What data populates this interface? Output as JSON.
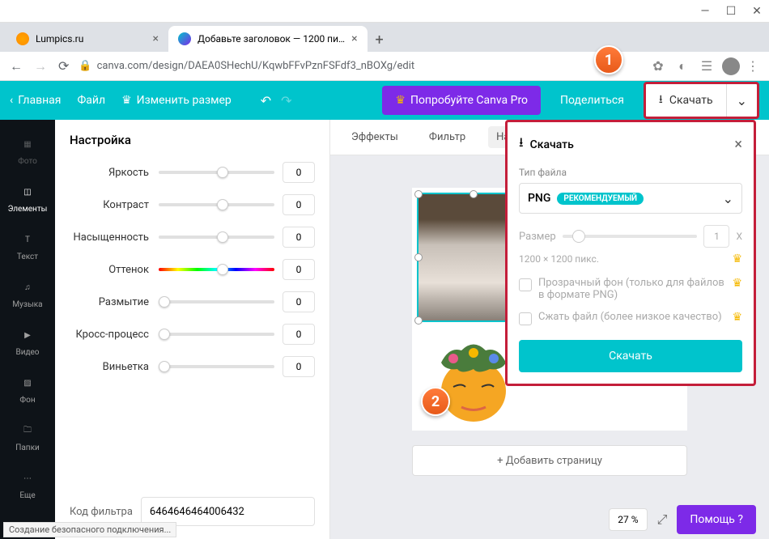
{
  "window": {
    "minimize": "—",
    "maximize": "☐",
    "close": "✕"
  },
  "tabs": [
    {
      "title": "Lumpics.ru"
    },
    {
      "title": "Добавьте заголовок — 1200 пи…"
    }
  ],
  "url": "canva.com/design/DAEA0SHechU/KqwbFFvPznFSFdf3_nBOXg/edit",
  "callouts": {
    "one": "1",
    "two": "2"
  },
  "menubar": {
    "home": "Главная",
    "file": "Файл",
    "resize": "Изменить размер",
    "try_pro": "Попробуйте Canva Pro",
    "share": "Поделиться",
    "download": "Скачать"
  },
  "sidenav": {
    "photo": "Фото",
    "elements": "Элементы",
    "text": "Текст",
    "music": "Музыка",
    "video": "Видео",
    "background": "Фон",
    "folders": "Папки",
    "more": "Еще"
  },
  "settings": {
    "title": "Настройка",
    "brightness": {
      "label": "Яркость",
      "value": "0"
    },
    "contrast": {
      "label": "Контраст",
      "value": "0"
    },
    "saturation": {
      "label": "Насыщенность",
      "value": "0"
    },
    "tint": {
      "label": "Оттенок",
      "value": "0"
    },
    "blur": {
      "label": "Размытие",
      "value": "0"
    },
    "xprocess": {
      "label": "Кросс-процесс",
      "value": "0"
    },
    "vignette": {
      "label": "Виньетка",
      "value": "0"
    },
    "filter_code_label": "Код фильтра",
    "filter_code_value": "6464646464006432"
  },
  "toptabs": {
    "effects": "Эффекты",
    "filter": "Фильтр",
    "settings": "Настр"
  },
  "canvas": {
    "add_page": "+ Добавить страницу"
  },
  "download_panel": {
    "title": "Скачать",
    "filetype_label": "Тип файла",
    "filetype": "PNG",
    "badge": "РЕКОМЕНДУЕМЫЙ",
    "size_label": "Размер",
    "size_value": "1",
    "size_x": "X",
    "dimensions": "1200 × 1200 пикс.",
    "transparent": "Прозрачный фон (только для файлов в формате PNG)",
    "compress": "Сжать файл (более низкое качество)",
    "button": "Скачать"
  },
  "bottom": {
    "zoom": "27 %",
    "help": "Помощь  ?"
  },
  "status": "Создание безопасного подключения..."
}
